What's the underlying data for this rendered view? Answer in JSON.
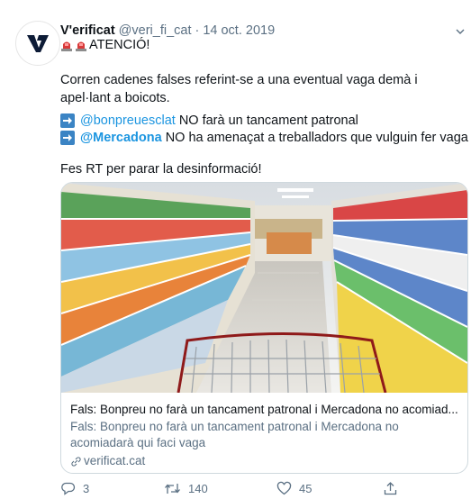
{
  "colors": {
    "accent": "#1b95e0",
    "muted": "#5b7083",
    "arrow_box": "#3b84c4",
    "siren": "#d83a3a"
  },
  "tweet": {
    "display_name": "V'erificat",
    "handle": "@veri_fi_cat",
    "separator": "·",
    "date": "14 oct. 2019",
    "alert_text": "ATENCIÓ!",
    "paragraph_1": "Corren cadenes falses referint-se a una eventual vaga demà i apel·lant a boicots.",
    "list": [
      {
        "mention": "@bonpreuesclat",
        "text": "NO farà un tancament patronal"
      },
      {
        "mention": "@Mercadona",
        "text": "NO ha amenaçat a treballadors que vulguin fer vaga"
      }
    ],
    "paragraph_3": "Fes RT per parar la desinformació!",
    "icons": {
      "avatar_logo": "verificat-logo",
      "siren": "police-light-icon",
      "list_bullet": "arrow-right-icon",
      "caret": "chevron-down-icon"
    }
  },
  "card": {
    "image": "supermarket-aisle-with-cart",
    "title": "Fals: Bonpreu no farà un tancament patronal i Mercadona no acomiad...",
    "description": "Fals: Bonpreu no farà un tancament patronal i Mercadona no acomiadarà qui faci vaga",
    "domain": "verificat.cat",
    "domain_icon": "link-icon"
  },
  "actions": {
    "reply_count": "3",
    "retweet_count": "140",
    "like_count": "45",
    "icons": [
      "reply-icon",
      "retweet-icon",
      "like-icon",
      "share-icon"
    ]
  }
}
